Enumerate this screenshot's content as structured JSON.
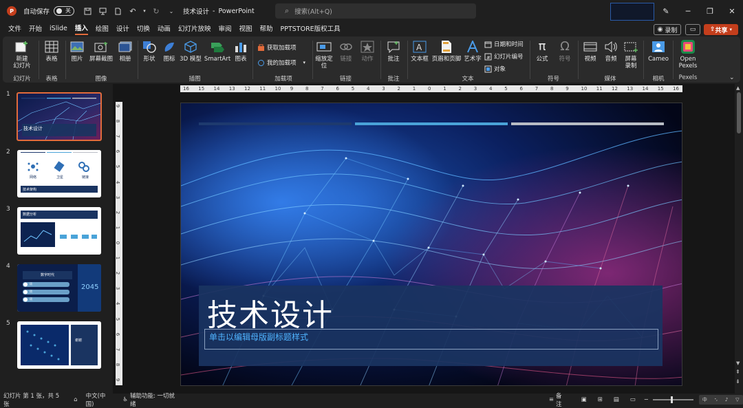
{
  "titlebar": {
    "autosave_label": "自动保存",
    "autosave_state": "关",
    "doc_name": "技术设计",
    "separator": "-",
    "app_name": "PowerPoint",
    "search_placeholder": "搜索(Alt+Q)"
  },
  "menu": {
    "tabs": [
      "文件",
      "开始",
      "iSlide",
      "插入",
      "绘图",
      "设计",
      "切换",
      "动画",
      "幻灯片放映",
      "审阅",
      "视图",
      "帮助",
      "PPTSTORE版权工具"
    ],
    "active_tab": "插入",
    "record_label": "录制",
    "share_label": "共享"
  },
  "ribbon": {
    "new_slide": "新建\n幻灯片",
    "table": "表格",
    "picture": "图片",
    "screenshot": "屏幕截图",
    "album": "相册",
    "shapes": "形状",
    "icons": "图标",
    "model3d": "3D 模型",
    "smartart": "SmartArt",
    "chart": "图表",
    "get_addins": "获取加载项",
    "my_addins": "我的加载项",
    "zoom": "缩放定位",
    "link": "链接",
    "action": "动作",
    "comment": "批注",
    "textbox": "文本框",
    "header_footer": "页眉和页脚",
    "wordart": "艺术字",
    "datetime": "日期和时间",
    "slide_number": "幻灯片编号",
    "object": "对象",
    "equation": "公式",
    "symbol": "符号",
    "video": "视频",
    "audio": "音频",
    "screen_record": "屏幕录制",
    "cameo": "Cameo",
    "pexels": "Open Pexels",
    "groups": {
      "slides": "幻灯片",
      "tables": "表格",
      "images": "图像",
      "illustrations": "插图",
      "addins": "加载项",
      "links": "链接",
      "comments": "批注",
      "text": "文本",
      "symbols": "符号",
      "media": "媒体",
      "camera": "相机",
      "pexels": "Pexels"
    }
  },
  "thumbnails": [
    {
      "num": "1",
      "title": "技术设计"
    },
    {
      "num": "2",
      "items": [
        "网络",
        "卫星",
        "链接"
      ],
      "footer": "技术架构"
    },
    {
      "num": "3",
      "title": "数据分析"
    },
    {
      "num": "4",
      "title": "数字时代",
      "bignum": "2045",
      "items": [
        "项",
        "项",
        "项"
      ]
    },
    {
      "num": "5",
      "title": "谢谢"
    }
  ],
  "slide": {
    "title": "技术设计",
    "subtitle": "单击以编辑母版副标题样式"
  },
  "ruler": {
    "h_ticks": [
      "16",
      "15",
      "14",
      "13",
      "12",
      "11",
      "10",
      "9",
      "8",
      "7",
      "6",
      "5",
      "4",
      "3",
      "2",
      "1",
      "0",
      "1",
      "2",
      "3",
      "4",
      "5",
      "6",
      "7",
      "8",
      "9",
      "10",
      "11",
      "12",
      "13",
      "14",
      "15",
      "16"
    ],
    "v_ticks": [
      "9",
      "8",
      "7",
      "6",
      "5",
      "4",
      "3",
      "2",
      "1",
      "0",
      "1",
      "2",
      "3",
      "4",
      "5",
      "6",
      "7",
      "8",
      "9"
    ]
  },
  "status": {
    "slide_info": "幻灯片 第 1 张，共 5 张",
    "language": "中文(中国)",
    "accessibility": "辅助功能: 一切就绪",
    "notes": "备注"
  },
  "colors": {
    "accent": "#c43e1c",
    "tab_underline": "#e26b3b",
    "slide_bar_1": "#1e3a6e",
    "slide_bar_2": "#4aa3d8",
    "slide_bar_3": "#b8bcc4",
    "title_box": "#1a3461"
  }
}
